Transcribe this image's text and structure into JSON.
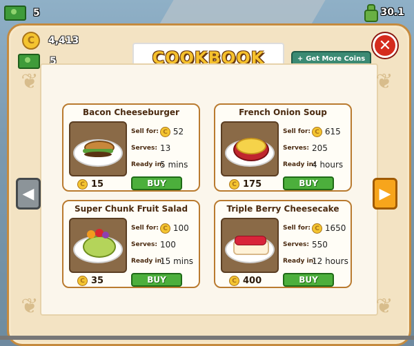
{
  "hud": {
    "cash": "5",
    "rating": "30.1"
  },
  "panel": {
    "coins": "4,413",
    "cash": "5",
    "title": "COOKBOOK",
    "get_more_coins_label": "Get More Coins",
    "close_symbol": "✕",
    "prev_symbol": "◀",
    "next_symbol": "▶"
  },
  "labels": {
    "sell_for": "Sell for:",
    "serves": "Serves:",
    "ready_in": "Ready in:",
    "buy": "BUY"
  },
  "recipes": [
    {
      "name": "Bacon Cheeseburger",
      "sell_for": "52",
      "serves": "13",
      "ready_in": "5 mins",
      "cost": "15",
      "icon": "burger"
    },
    {
      "name": "French Onion Soup",
      "sell_for": "615",
      "serves": "205",
      "ready_in": "4 hours",
      "cost": "175",
      "icon": "soup"
    },
    {
      "name": "Super Chunk Fruit Salad",
      "sell_for": "100",
      "serves": "100",
      "ready_in": "15 mins",
      "cost": "35",
      "icon": "fruit-salad"
    },
    {
      "name": "Triple Berry Cheesecake",
      "sell_for": "1650",
      "serves": "550",
      "ready_in": "12 hours",
      "cost": "400",
      "icon": "cheesecake"
    }
  ],
  "colors": {
    "panel_border": "#c58a3e",
    "buy_green": "#4caf3c",
    "title_yellow": "#f6c12c",
    "close_red": "#d52b1e"
  }
}
